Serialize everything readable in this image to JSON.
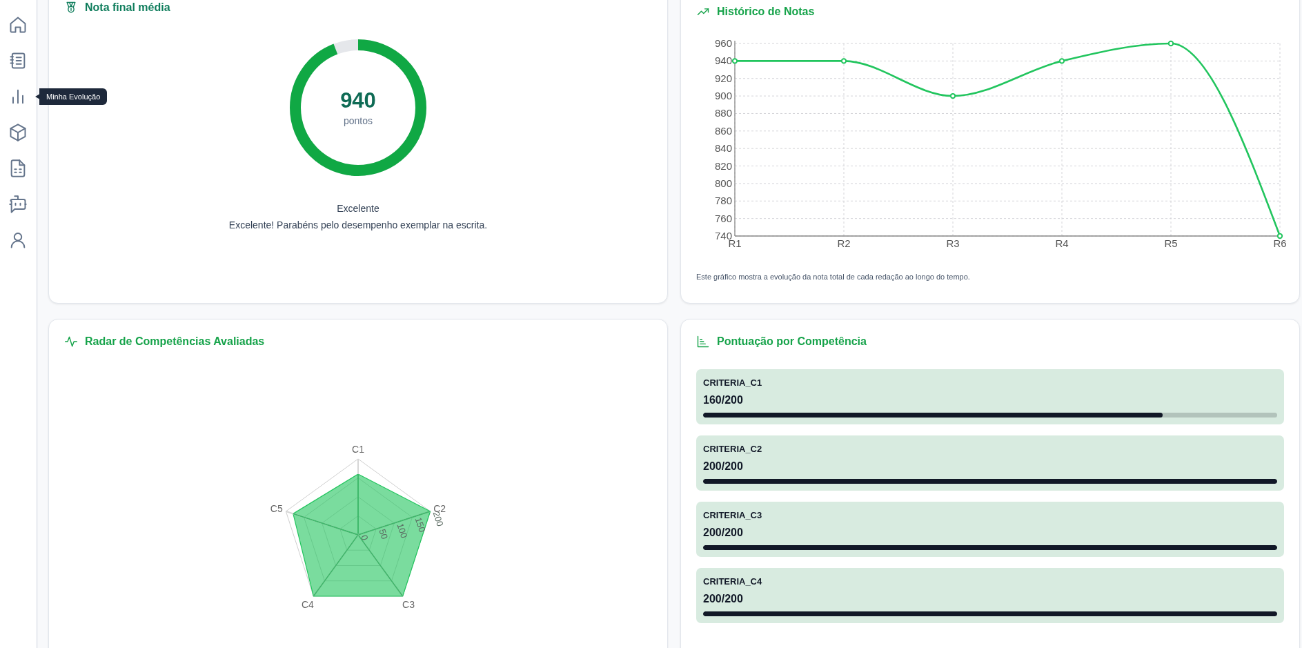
{
  "sidebar": {
    "tooltip": "Minha Evolução"
  },
  "score_card": {
    "title": "Nota final média",
    "score": "940",
    "unit": "pontos",
    "level": 0.94,
    "rating": "Excelente",
    "message": "Excelente! Parabéns pelo desempenho exemplar na escrita."
  },
  "history_card": {
    "title": "Histórico de Notas",
    "chart_data": {
      "type": "line",
      "categories": [
        "R1",
        "R2",
        "R3",
        "R4",
        "R5",
        "R6"
      ],
      "values": [
        940,
        940,
        900,
        940,
        960,
        740
      ],
      "grid": true,
      "marker": true,
      "ylim": [
        740,
        960
      ],
      "yticks": [
        740,
        760,
        780,
        800,
        820,
        840,
        860,
        880,
        900,
        920,
        940,
        960
      ]
    },
    "caption": "Este gráfico mostra a evolução da nota total de cada redação ao longo do tempo."
  },
  "radar_card": {
    "title": "Radar de Competências Avaliadas",
    "ticks": [
      "0",
      "50",
      "100",
      "150",
      "200"
    ],
    "axes": [
      {
        "label": "C1",
        "level": 0.8
      },
      {
        "label": "C2",
        "level": 1
      },
      {
        "label": "C3",
        "level": 1
      },
      {
        "label": "C4",
        "level": 1
      },
      {
        "label": "C5",
        "level": 0.9
      }
    ]
  },
  "competency_card": {
    "title": "Pontuação por Competência",
    "items": [
      {
        "name": "CRITERIA_C1",
        "score": "160/200",
        "level": 0.8
      },
      {
        "name": "CRITERIA_C2",
        "score": "200/200",
        "level": 1
      },
      {
        "name": "CRITERIA_C3",
        "score": "200/200",
        "level": 1
      },
      {
        "name": "CRITERIA_C4",
        "score": "200/200",
        "level": 1
      }
    ]
  }
}
